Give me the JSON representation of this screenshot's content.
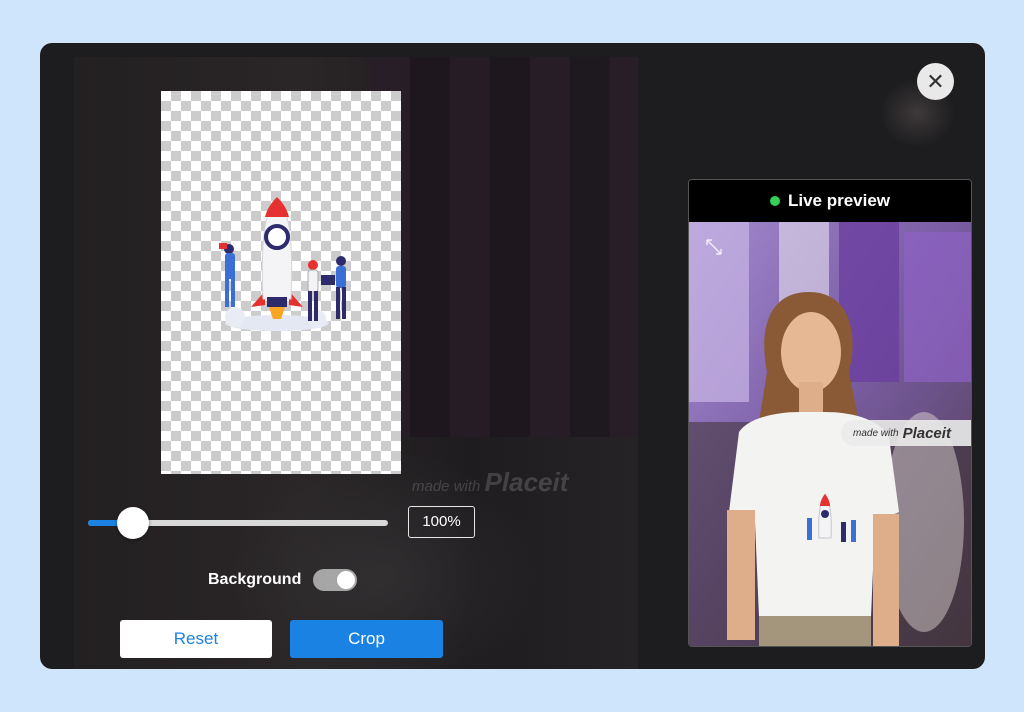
{
  "editor": {
    "zoom_value": "100%",
    "zoom_fraction": 0.15,
    "background_label": "Background",
    "background_enabled": true,
    "reset_label": "Reset",
    "crop_label": "Crop",
    "ghost_watermark_small": "made with",
    "ghost_watermark_big": "Placeit"
  },
  "preview": {
    "title": "Live preview",
    "watermark_small": "made with",
    "watermark_big": "Placeit"
  },
  "icons": {
    "close": "close-icon",
    "expand": "expand-icon",
    "live_status": "live-dot-icon"
  },
  "colors": {
    "accent": "#1a82e2",
    "live": "#34d058",
    "modal_bg": "#1d1d1f",
    "page_bg": "#cfe5fc"
  }
}
